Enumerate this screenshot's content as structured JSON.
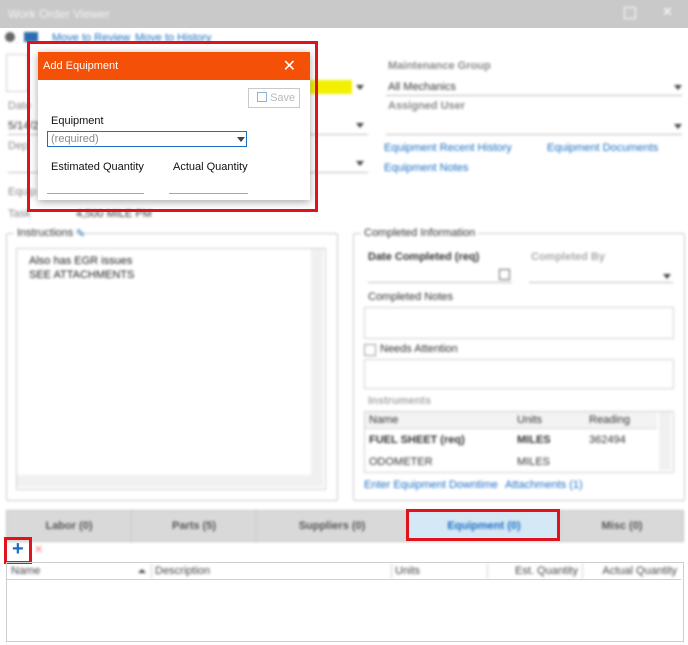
{
  "window": {
    "title": "Work Order Viewer",
    "menu": [
      "Move to Review",
      "Move to History"
    ]
  },
  "header": {
    "maintenance_group_label": "Maintenance Group",
    "maintenance_group_value": "All Mechanics",
    "assigned_user_label": "Assigned User",
    "date_label": "Date",
    "date_value": "5/14/2",
    "dept_label": "Dep",
    "equipment_label": "Equip",
    "eq_row_label": "Task",
    "eq_row_value": "4,500 MILE PM",
    "links": [
      "Equipment Recent History",
      "Equipment Documents",
      "Equipment Notes"
    ]
  },
  "instructions": {
    "label": "Instructions",
    "lines": [
      "Also has EGR issues",
      "SEE ATTACHMENTS"
    ]
  },
  "completed": {
    "label": "Completed Information",
    "date_completed_label": "Date Completed (req)",
    "completed_by_label": "Completed By",
    "notes_label": "Completed Notes",
    "needs_attention_label": "Needs Attention",
    "instruments_label": "Instruments",
    "columns": [
      "Name",
      "Units",
      "Reading"
    ],
    "rows": [
      {
        "name": "FUEL SHEET (req)",
        "units": "MILES",
        "reading": "362494"
      },
      {
        "name": "ODOMETER",
        "units": "MILES",
        "reading": ""
      }
    ],
    "downtime_link": "Enter Equipment Downtime",
    "attachments_link": "Attachments (1)"
  },
  "tabs": [
    {
      "label": "Labor  (0)"
    },
    {
      "label": "Parts  (5)"
    },
    {
      "label": "Suppliers  (0)"
    },
    {
      "label": "Equipment  (0)"
    },
    {
      "label": "Misc  (0)"
    }
  ],
  "grid": {
    "columns": [
      "Name",
      "Description",
      "Units",
      "Est. Quantity",
      "Actual Quantity"
    ]
  },
  "dialog": {
    "title": "Add Equipment",
    "save_label": "Save",
    "equipment_label": "Equipment",
    "equipment_placeholder": "(required)",
    "est_qty_label": "Estimated Quantity",
    "act_qty_label": "Actual Quantity"
  },
  "colors": {
    "dialog_header": "#f55008",
    "highlight": "#e0131d",
    "link": "#1a6fc4"
  }
}
